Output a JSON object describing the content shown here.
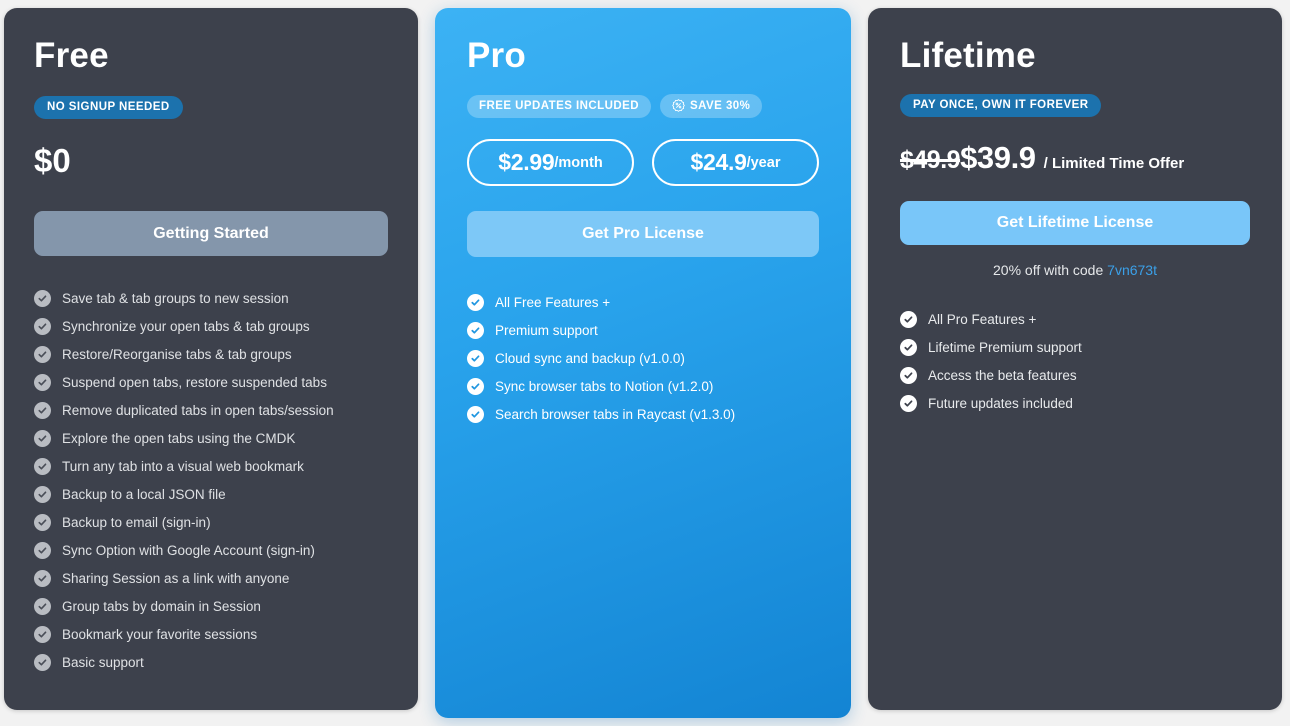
{
  "theme": {
    "page_background": "#f2f2f2",
    "card_dark": "#3d414c",
    "card_pro_blue": "#29a3ec",
    "badge_dark_blue": "#1c72ad",
    "cta_free_gray": "#8496ab",
    "cta_blue": "#7dc8f7",
    "promo_code_color": "#3ba0e8"
  },
  "plans": {
    "free": {
      "title": "Free",
      "badges": [
        {
          "label": "NO SIGNUP NEEDED",
          "icon": ""
        }
      ],
      "price": "$0",
      "cta_label": "Getting Started",
      "features": [
        "Save tab & tab groups to new session",
        "Synchronize your open tabs & tab groups",
        "Restore/Reorganise tabs & tab groups",
        "Suspend open tabs, restore suspended tabs",
        "Remove duplicated tabs in open tabs/session",
        "Explore the open tabs using the CMDK",
        "Turn any tab into a visual web bookmark",
        "Backup to a local JSON file",
        "Backup to email (sign-in)",
        "Sync Option with Google Account (sign-in)",
        "Sharing Session as a link with anyone",
        "Group tabs by domain in Session",
        "Bookmark your favorite sessions",
        "Basic support"
      ]
    },
    "pro": {
      "title": "Pro",
      "badges": [
        {
          "label": "FREE UPDATES INCLUDED",
          "icon": ""
        },
        {
          "label": "SAVE 30%",
          "icon": "discount-seal-icon"
        }
      ],
      "price_options": [
        {
          "amount": "$2.99",
          "period": "/month"
        },
        {
          "amount": "$24.9",
          "period": "/year"
        }
      ],
      "cta_label": "Get Pro License",
      "features": [
        "All Free Features +",
        "Premium support",
        "Cloud sync and backup (v1.0.0)",
        "Sync browser tabs to Notion (v1.2.0)",
        "Search browser tabs in Raycast (v1.3.0)"
      ]
    },
    "lifetime": {
      "title": "Lifetime",
      "badges": [
        {
          "label": "PAY ONCE, OWN IT FOREVER",
          "icon": ""
        }
      ],
      "price_old": "$49.9",
      "price_new": "$39.9",
      "price_note": "/ Limited Time Offer",
      "cta_label": "Get Lifetime License",
      "promo_prefix": "20% off with code ",
      "promo_code": "7vn673t",
      "features": [
        "All Pro Features +",
        "Lifetime Premium support",
        "Access the beta features",
        "Future updates included"
      ]
    }
  }
}
